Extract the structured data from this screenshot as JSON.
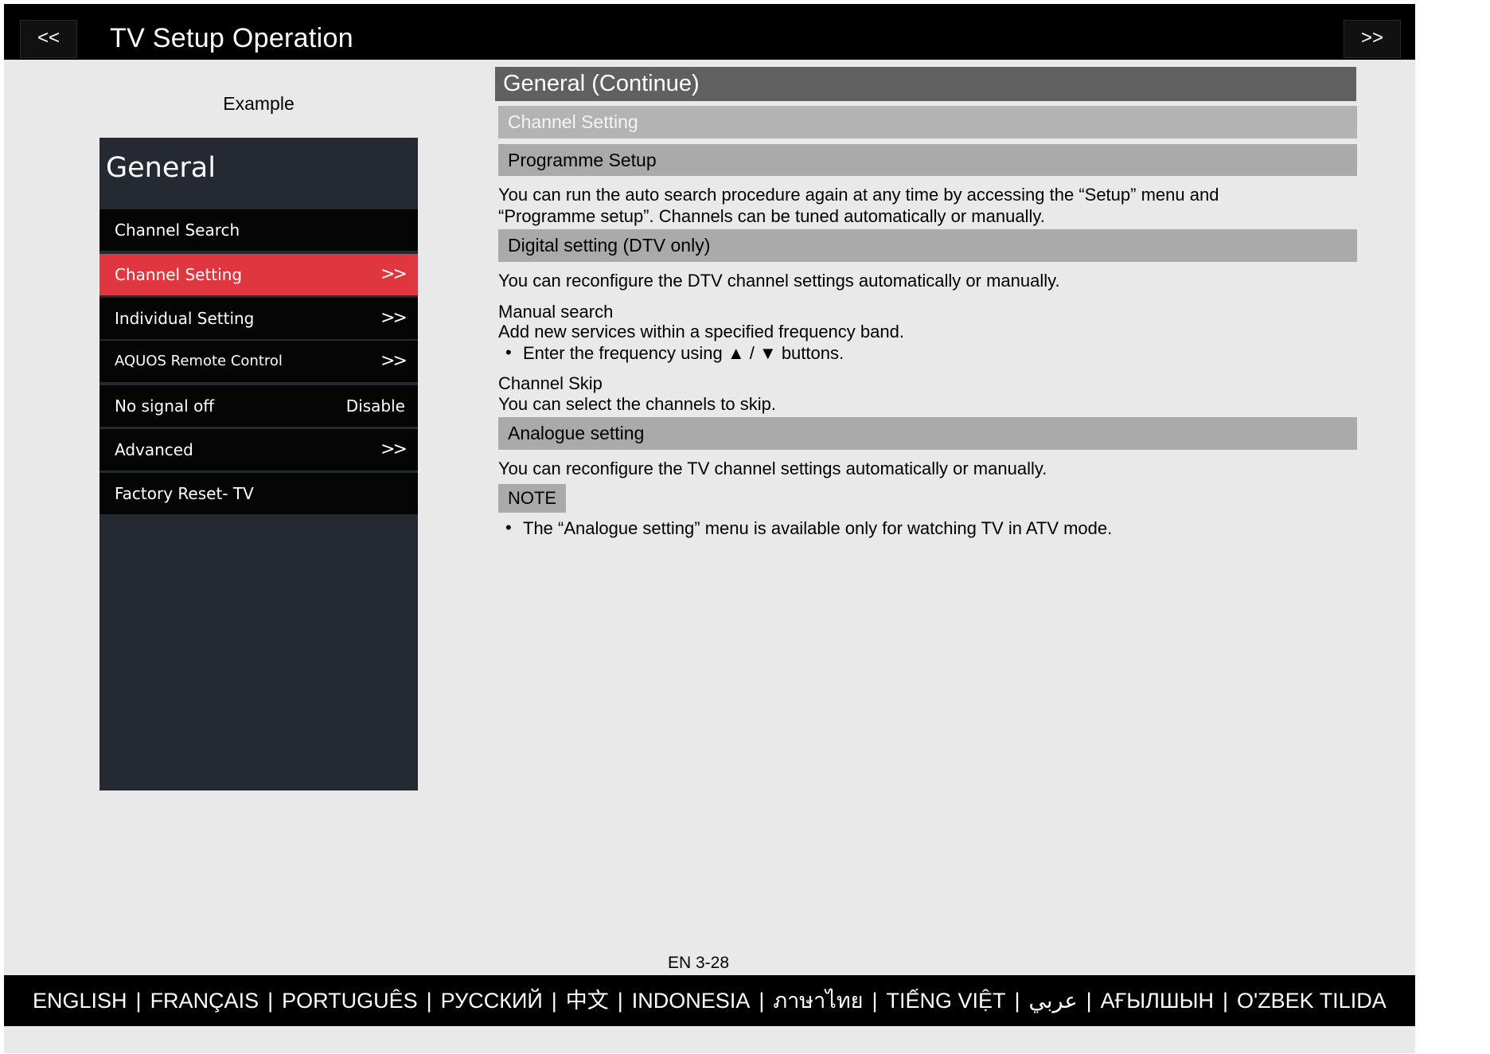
{
  "header": {
    "prev_label": "<<",
    "next_label": ">>",
    "title": "TV Setup Operation"
  },
  "example_label": "Example",
  "tv_menu": {
    "title": "General",
    "items": [
      {
        "label": "Channel Search",
        "value": "",
        "chevron": ""
      },
      {
        "label": "Channel Setting",
        "value": "",
        "chevron": ">>"
      },
      {
        "label": "Individual Setting",
        "value": "",
        "chevron": ">>"
      },
      {
        "label": "AQUOS Remote Control",
        "value": "",
        "chevron": ">>"
      },
      {
        "label": "No signal off",
        "value": "Disable",
        "chevron": ""
      },
      {
        "label": "Advanced",
        "value": "",
        "chevron": ">>"
      },
      {
        "label": "Factory Reset- TV",
        "value": "",
        "chevron": ""
      }
    ],
    "active_index": 1,
    "active_color": "#e0363f"
  },
  "content": {
    "section_title": "General (Continue)",
    "channel_setting": "Channel Setting",
    "programme_setup": "Programme Setup",
    "programme_text_1": "You can run the auto search procedure again at any time by accessing the “Setup” menu and",
    "programme_text_2": "“Programme setup”. Channels can be tuned automatically or manually.",
    "digital_setting": "Digital setting (DTV only)",
    "digital_text": "You can reconfigure the DTV channel settings automatically or manually.",
    "manual_search_title": "Manual search",
    "manual_search_text": "Add new services within a specified frequency band.",
    "manual_search_bullet": "Enter the frequency using ▲ / ▼ buttons.",
    "channel_skip_title": "Channel Skip",
    "channel_skip_text": "You can select the channels to skip.",
    "analogue_setting": "Analogue setting",
    "analogue_text": "You can reconfigure the TV channel settings automatically or manually.",
    "note_label": "NOTE",
    "note_bullet": "The “Analogue setting” menu is available only for watching TV in ATV mode.",
    "bullet_char": "•"
  },
  "page_number": "EN 3-28",
  "footer": {
    "separator": "|",
    "languages": [
      "ENGLISH",
      "FRANÇAIS",
      "PORTUGUÊS",
      "РУССКИЙ",
      "中文",
      "INDONESIA",
      "ภาษาไทย",
      "TIẾNG VIỆT",
      "عربي",
      "АҒЫЛШЫН",
      "O'ZBEK TILIDA"
    ]
  }
}
